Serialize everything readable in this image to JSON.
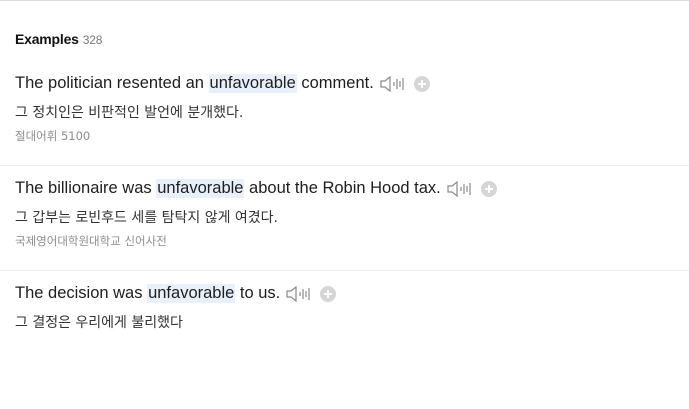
{
  "header": {
    "title": "Examples",
    "count": "328"
  },
  "examples": [
    {
      "before": "The politician resented an ",
      "keyword": "unfavorable",
      "after": " comment.",
      "translation": "그 정치인은 비판적인 발언에 분개했다.",
      "source": "절대어휘 5100"
    },
    {
      "before": "The billionaire was ",
      "keyword": "unfavorable",
      "after": " about the Robin Hood tax.",
      "translation": "그 갑부는 로빈후드 세를 탐탁지 않게 여겼다.",
      "source": "국제영어대학원대학교 신어사전"
    },
    {
      "before": "The decision was ",
      "keyword": "unfavorable",
      "after": " to us.",
      "translation": "그 결정은 우리에게 불리했다",
      "source": ""
    }
  ]
}
